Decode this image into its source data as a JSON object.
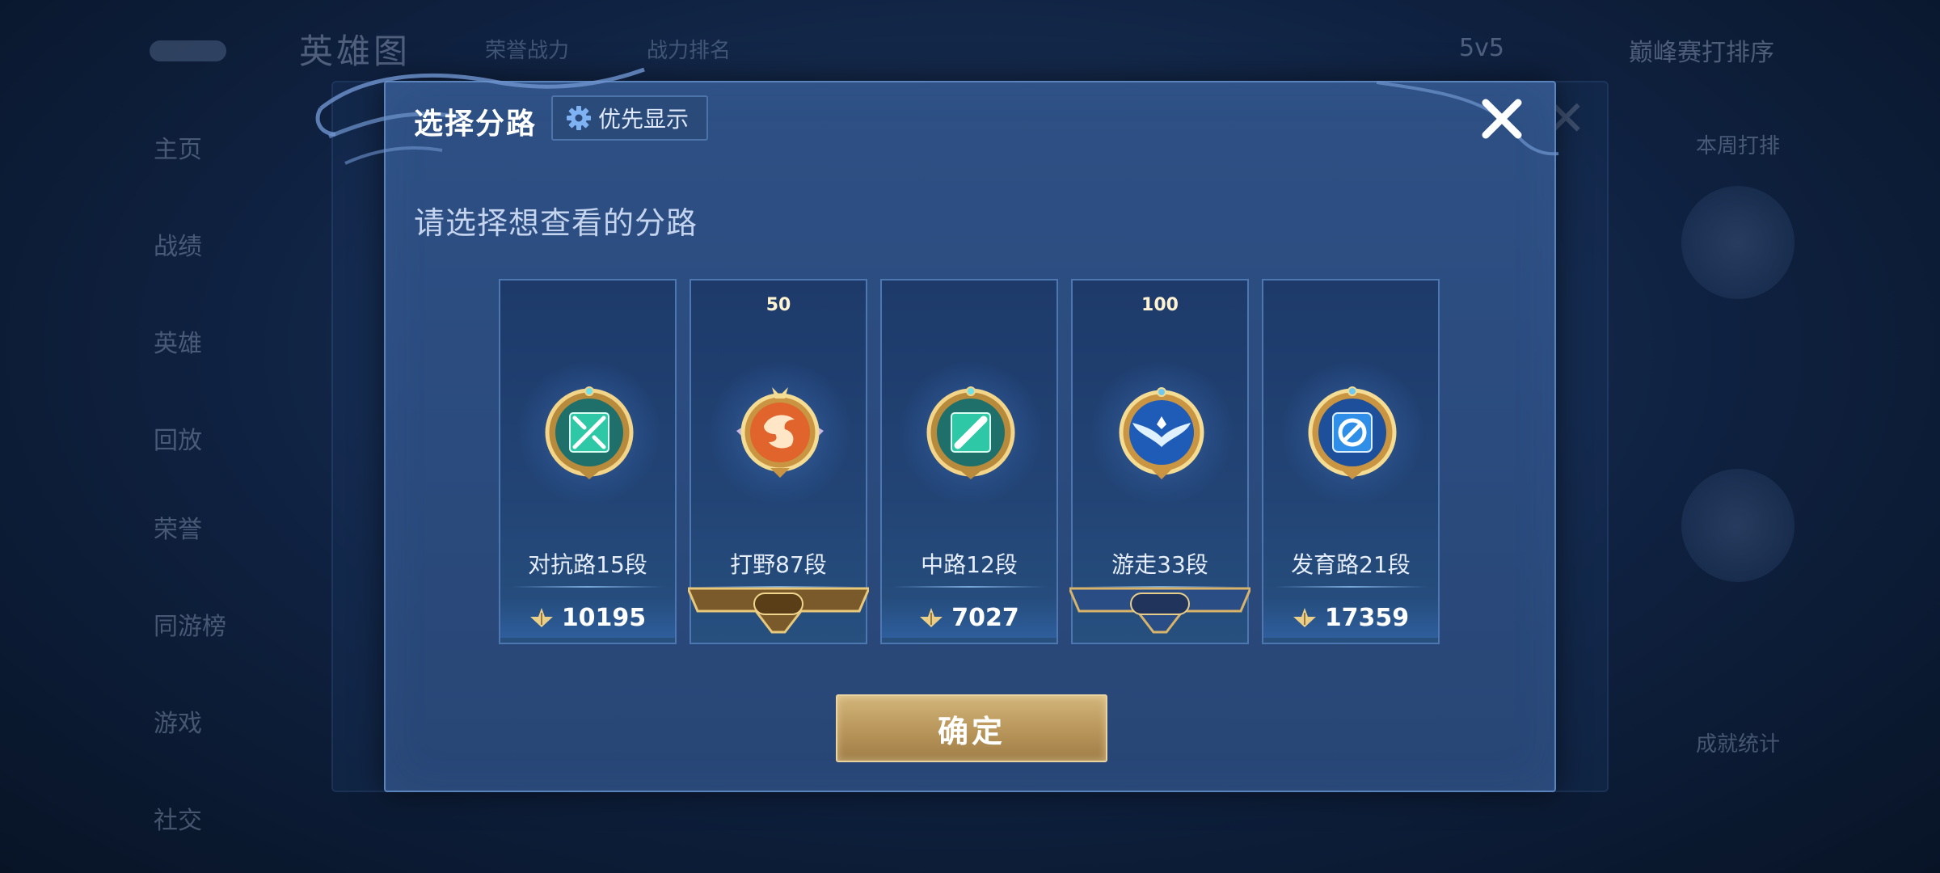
{
  "background": {
    "title": "英雄图",
    "chips": [
      "荣誉战力",
      "战力排名"
    ],
    "mode": "5v5",
    "region": "巅峰赛打排序",
    "sidebar": [
      "主页",
      "战绩",
      "英雄",
      "回放",
      "荣誉",
      "同游榜",
      "游戏",
      "社交"
    ],
    "right_labels": [
      "本周打排",
      "成就统计"
    ]
  },
  "modal": {
    "title": "选择分路",
    "priority_button": "优先显示",
    "subtitle": "请选择想查看的分路",
    "confirm_button": "确定"
  },
  "lanes": [
    {
      "name": "对抗路15段",
      "score": "10195",
      "banner": null,
      "emblem": "clash-lane-emblem",
      "accent": "#2ec8a6"
    },
    {
      "name": "打野87段",
      "score": null,
      "banner": "50",
      "emblem": "jungle-dragon-emblem",
      "accent": "#e0642b"
    },
    {
      "name": "中路12段",
      "score": "7027",
      "banner": null,
      "emblem": "mid-lane-emblem",
      "accent": "#2ec8a6"
    },
    {
      "name": "游走33段",
      "score": null,
      "banner": "100",
      "emblem": "roam-wings-emblem",
      "accent": "#2f7fe0"
    },
    {
      "name": "发育路21段",
      "score": "17359",
      "banner": null,
      "emblem": "farm-lane-emblem",
      "accent": "#2f8fe8"
    }
  ]
}
